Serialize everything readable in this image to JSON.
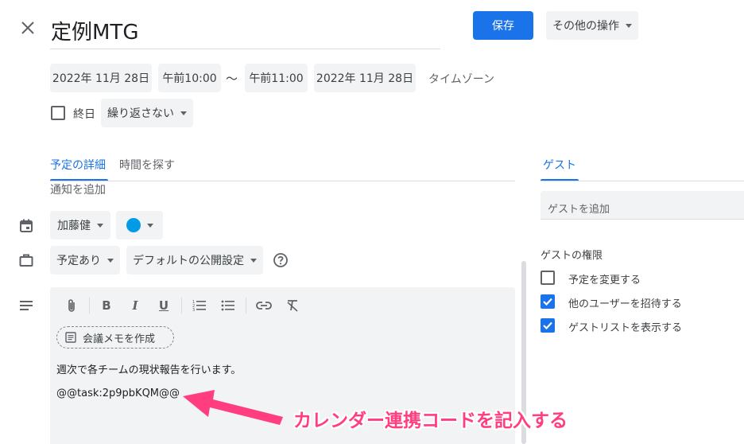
{
  "header": {
    "title": "定例MTG",
    "save_label": "保存",
    "more_actions_label": "その他の操作"
  },
  "datetime": {
    "start_date": "2022年 11月 28日",
    "start_time": "午前10:00",
    "separator": "〜",
    "end_time": "午前11:00",
    "end_date": "2022年 11月 28日",
    "timezone_label": "タイムゾーン"
  },
  "options": {
    "all_day_label": "終日",
    "all_day_checked": false,
    "repeat_label": "繰り返さない"
  },
  "tabs": {
    "details_label": "予定の詳細",
    "find_time_label": "時間を探す"
  },
  "details": {
    "add_notification_label": "通知を追加",
    "calendar_owner": "加藤健",
    "event_color": "#039be5",
    "availability_label": "予定あり",
    "visibility_label": "デフォルトの公開設定",
    "help_icon": "help-circle-icon"
  },
  "editor": {
    "meeting_notes_label": "会議メモを作成",
    "description_line1": "週次で各チームの現状報告を行います。",
    "description_line2": "@@task:2p9pbKQM@@"
  },
  "guests": {
    "tab_label": "ゲスト",
    "add_guest_placeholder": "ゲストを追加",
    "permissions_title": "ゲストの権限",
    "permissions": [
      {
        "label": "予定を変更する",
        "checked": false
      },
      {
        "label": "他のユーザーを招待する",
        "checked": true
      },
      {
        "label": "ゲストリストを表示する",
        "checked": true
      }
    ]
  },
  "annotation": {
    "text": "カレンダー連携コードを記入する",
    "color": "#ff3d7f"
  },
  "colors": {
    "accent": "#1a73e8",
    "chip_bg": "#f1f3f4"
  }
}
